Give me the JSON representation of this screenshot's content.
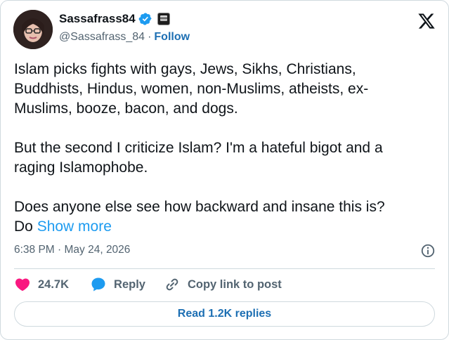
{
  "author": {
    "display_name": "Sassafrass84",
    "handle": "@Sassafrass_84",
    "separator": "·",
    "follow_label": "Follow"
  },
  "tweet": {
    "paragraph_1": "Islam picks fights with gays, Jews, Sikhs, Christians,\nBuddhists, Hindus, women, non-Muslims, atheists, ex-\nMuslims, booze, bacon, and dogs.",
    "paragraph_2": "But the second I criticize Islam? I'm a hateful bigot and a\nraging Islamophobe.",
    "paragraph_3": "Does anyone else see how backward and insane this is?\nDo ",
    "show_more_label": "Show more",
    "timestamp": "6:38 PM · May 24, 2026"
  },
  "actions": {
    "like_count": "24.7K",
    "reply_label": "Reply",
    "copy_link_label": "Copy link to post"
  },
  "replies_button_label": "Read 1.2K replies",
  "colors": {
    "like_heart": "#f91880",
    "reply_bubble": "#1d9bf0",
    "verified_badge": "#1d9bf0",
    "link": "#1d9bf0",
    "secondary_text": "#536471"
  },
  "icons": [
    "verified-badge-icon",
    "affiliation-badge-icon",
    "x-logo-icon",
    "info-icon",
    "heart-icon",
    "reply-icon",
    "link-icon"
  ]
}
